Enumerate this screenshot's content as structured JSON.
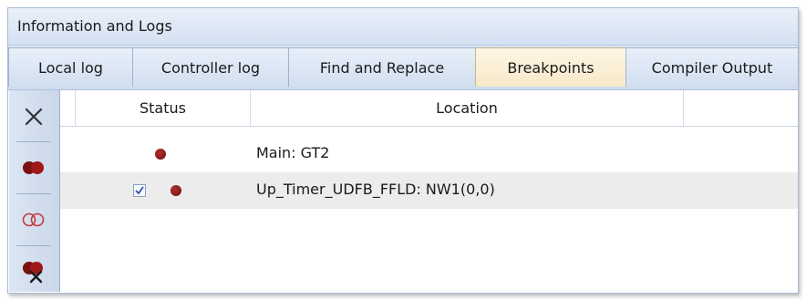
{
  "panel": {
    "title": "Information and Logs"
  },
  "tabs": [
    {
      "label": "Local log",
      "active": false
    },
    {
      "label": "Controller log",
      "active": false
    },
    {
      "label": "Find and Replace",
      "active": false
    },
    {
      "label": "Breakpoints",
      "active": true
    },
    {
      "label": "Compiler Output",
      "active": false
    }
  ],
  "toolbar": {
    "buttons": [
      {
        "icon": "close-icon"
      },
      {
        "icon": "breakpoint-enable-icon"
      },
      {
        "icon": "breakpoint-disable-icon"
      },
      {
        "icon": "breakpoint-delete-icon"
      }
    ]
  },
  "grid": {
    "columns": [
      "Status",
      "Location"
    ],
    "rows": [
      {
        "location": "Main: GT2",
        "has_checkbox": false,
        "checked": false,
        "selected": false
      },
      {
        "location": "Up_Timer_UDFB_FFLD: NW1(0,0)",
        "has_checkbox": true,
        "checked": true,
        "selected": true
      }
    ]
  },
  "colors": {
    "accent": "#d4e1f2",
    "active_tab": "#f7e9c8",
    "breakpoint": "#8b1414"
  }
}
